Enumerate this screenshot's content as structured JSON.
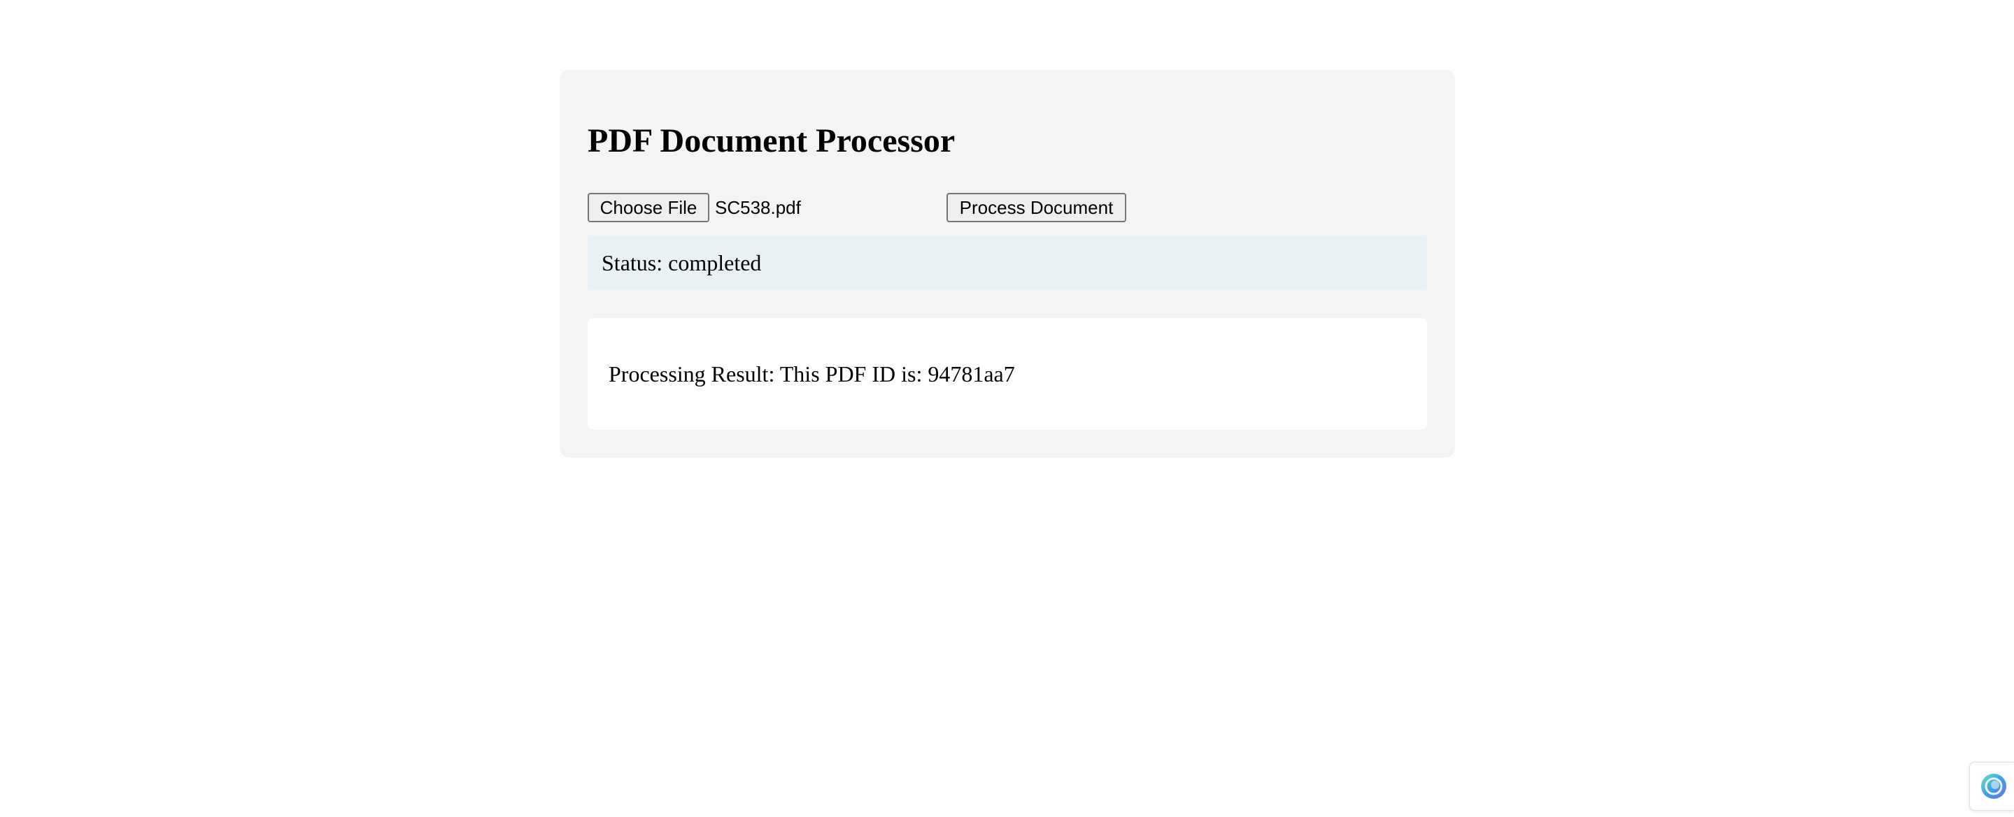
{
  "app": {
    "title": "PDF Document Processor"
  },
  "file_input": {
    "button_label": "Choose File",
    "selected_file": "SC538.pdf"
  },
  "actions": {
    "process_label": "Process Document"
  },
  "status": {
    "text": "Status: completed"
  },
  "result": {
    "text": "Processing Result: This PDF ID is: 94781aa7"
  },
  "floating_widget": {
    "icon": "assistant-orb-icon"
  },
  "colors": {
    "page_background": "#ffffff",
    "card_background": "#f4f4f4",
    "status_background": "#e8f2f5",
    "result_background": "#ffffff",
    "button_background": "#efefef",
    "button_border": "#767676"
  }
}
